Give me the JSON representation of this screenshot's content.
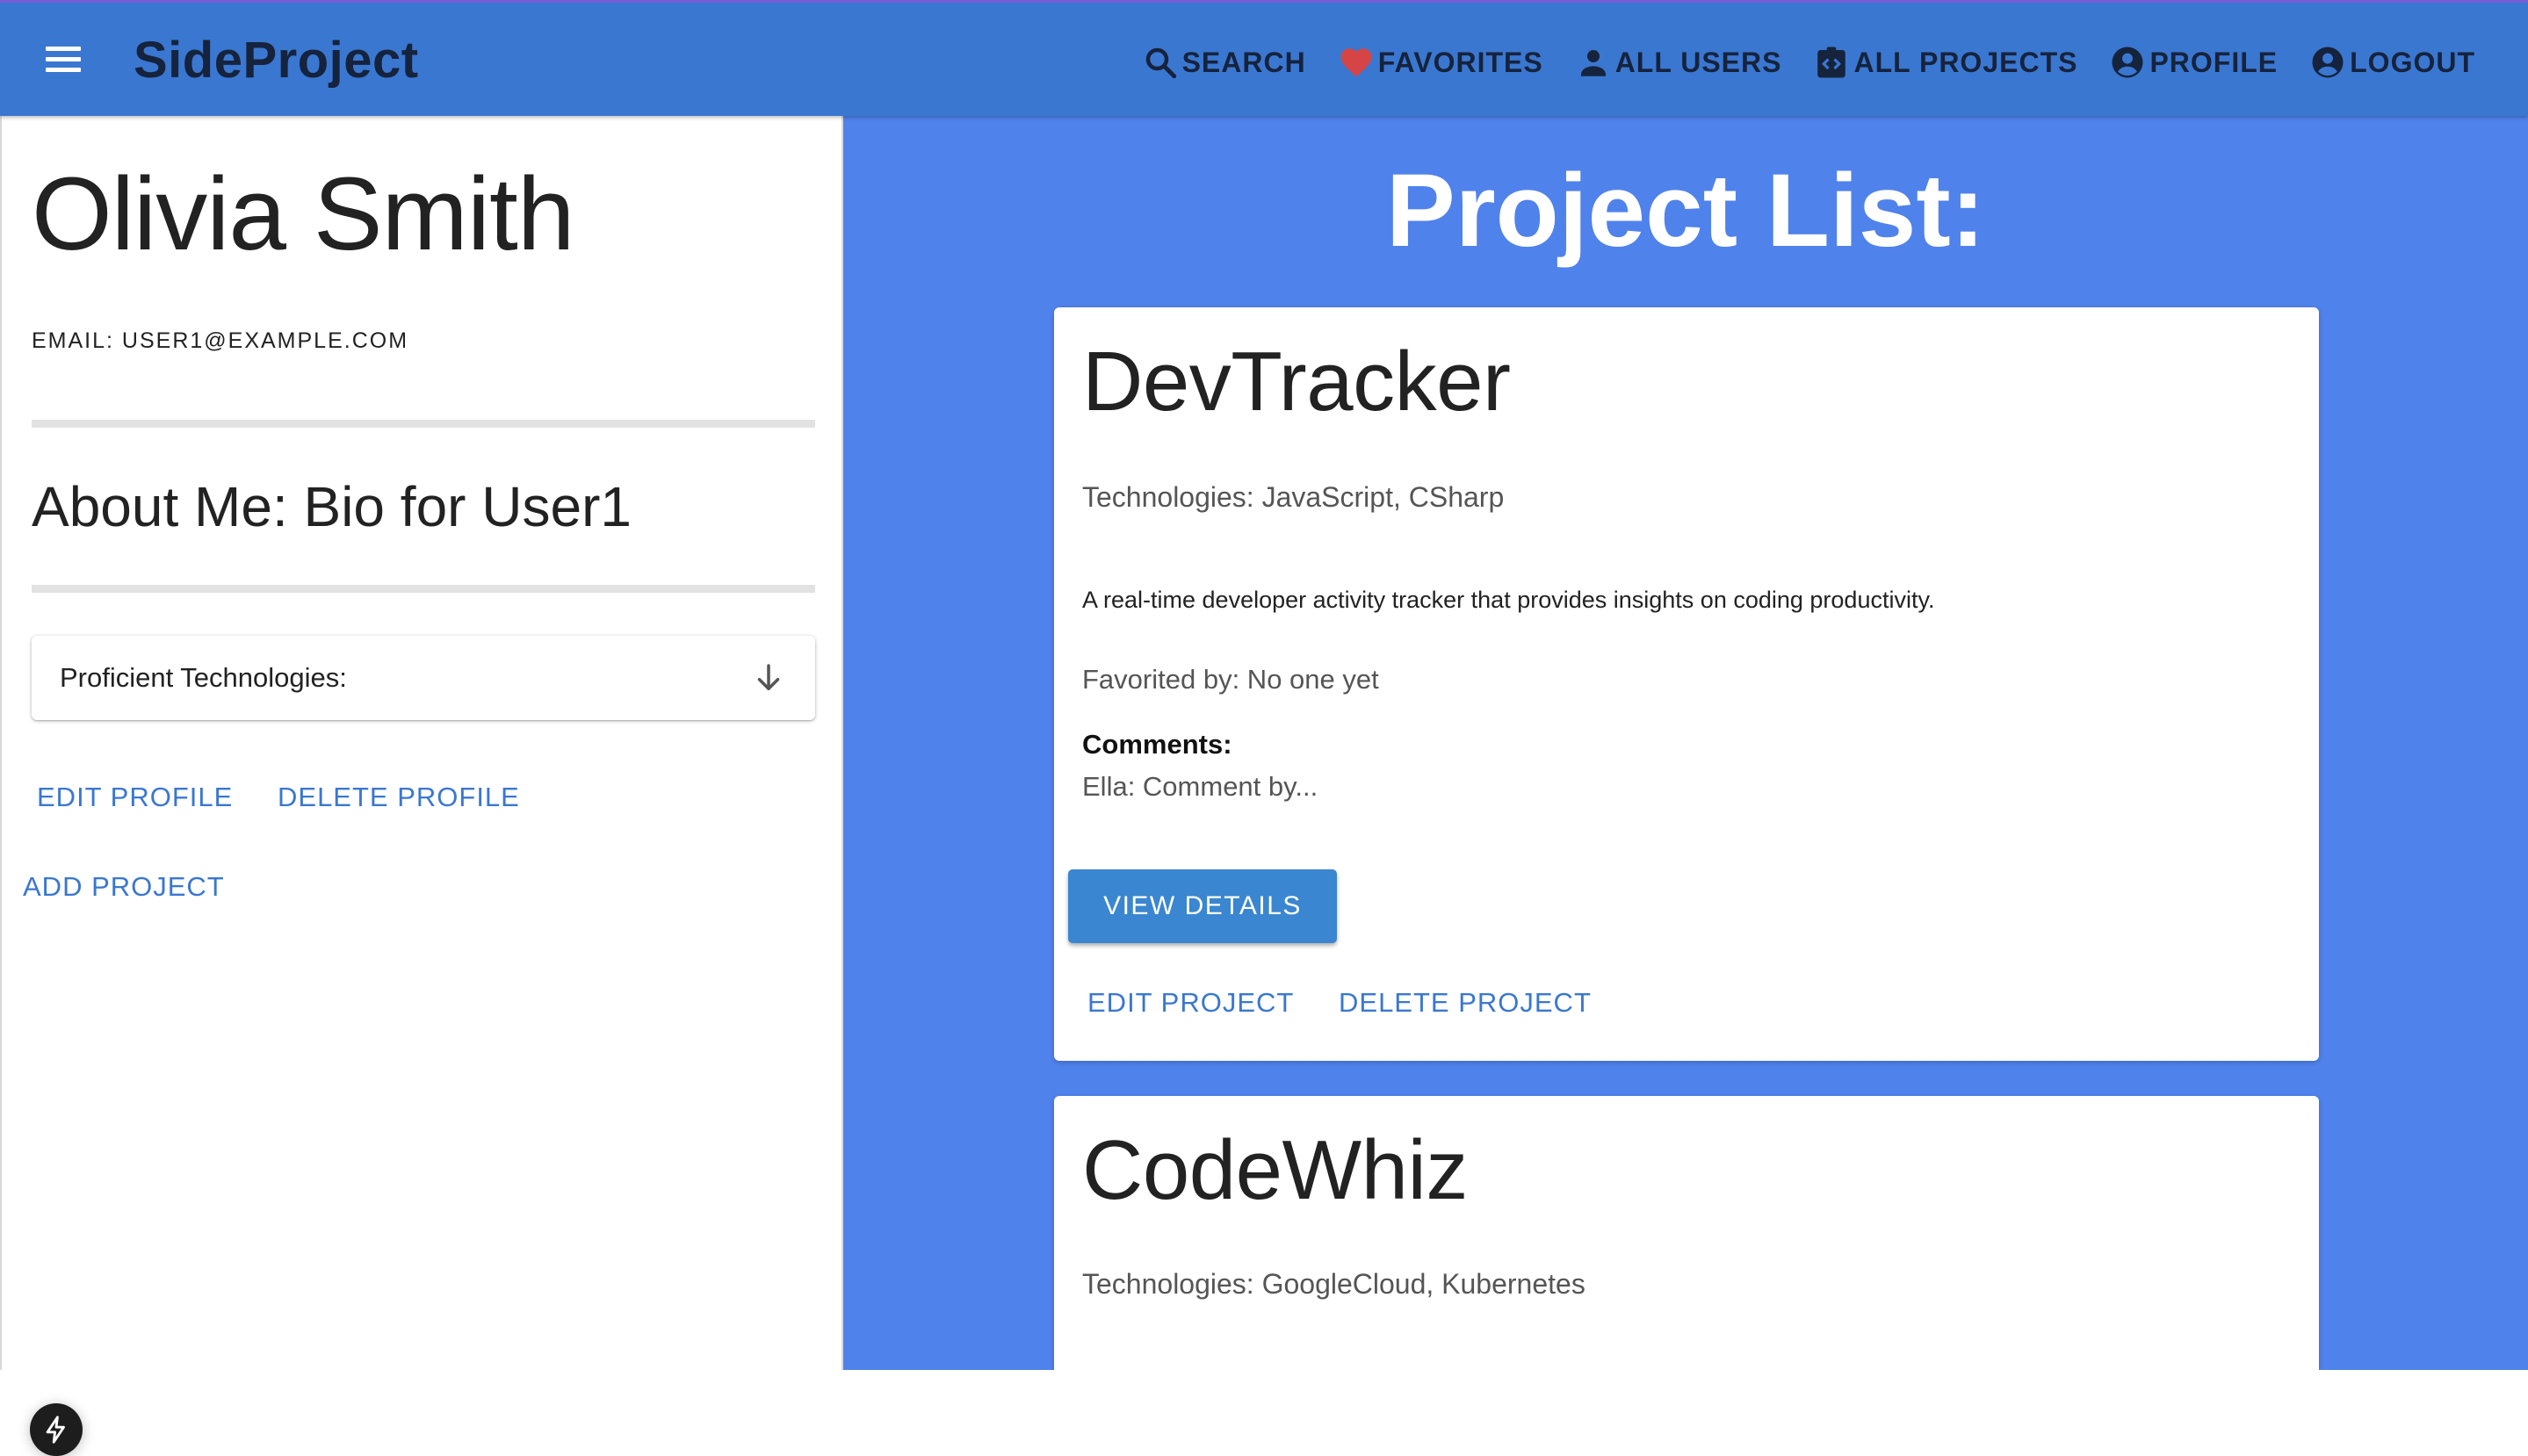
{
  "app": {
    "brand": "SideProject",
    "nav": [
      {
        "label": "SEARCH",
        "icon": "search-icon"
      },
      {
        "label": "FAVORITES",
        "icon": "heart-icon"
      },
      {
        "label": "ALL USERS",
        "icon": "person-icon"
      },
      {
        "label": "ALL PROJECTS",
        "icon": "code-clipboard-icon"
      },
      {
        "label": "PROFILE",
        "icon": "account-circle-icon"
      },
      {
        "label": "LOGOUT",
        "icon": "account-circle-icon"
      }
    ]
  },
  "colors": {
    "appbar": "#3a77d0",
    "page_background": "#5082ec",
    "heart": "#d64545",
    "link": "#3a77d0",
    "primary_button": "#3a86d0"
  },
  "profile": {
    "name": "Olivia Smith",
    "email": "EMAIL: USER1@EXAMPLE.COM",
    "about": "About Me: Bio for User1",
    "technologies_label": "Proficient Technologies:",
    "edit_label": "EDIT PROFILE",
    "delete_label": "DELETE PROFILE",
    "add_project_label": "ADD PROJECT"
  },
  "projects": {
    "title": "Project List:",
    "items": [
      {
        "name": "DevTracker",
        "technologies": "Technologies: JavaScript, CSharp",
        "description": "A real-time developer activity tracker that provides insights on coding productivity.",
        "favorited_by": "Favorited by: No one yet",
        "comments_label": "Comments:",
        "comment": "Ella: Comment by...",
        "view_label": "VIEW DETAILS",
        "edit_label": "EDIT PROJECT",
        "delete_label": "DELETE PROJECT"
      },
      {
        "name": "CodeWhiz",
        "technologies": "Technologies: GoogleCloud, Kubernetes"
      }
    ]
  }
}
